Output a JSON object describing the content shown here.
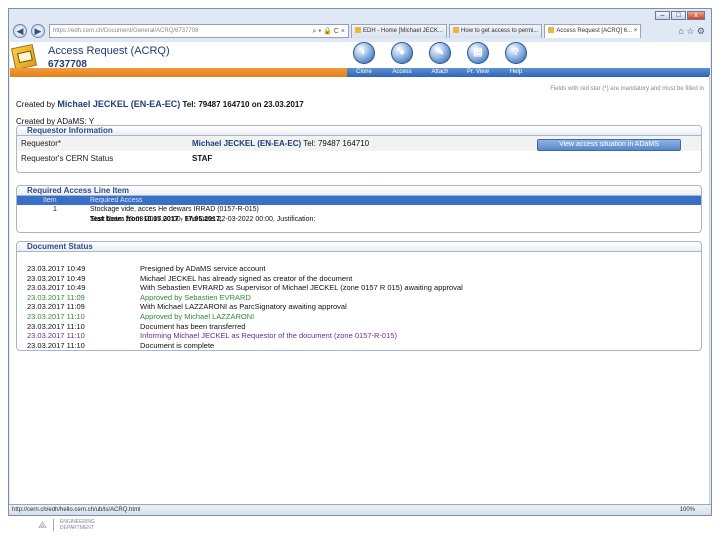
{
  "browser": {
    "address_url": "https://edh.cern.ch/Document/General/ACRQ/6737708",
    "tabs": [
      "EDH - Home [Michael JECK...",
      "How to get access to permi...",
      "Access Request [ACRQ] 6..."
    ],
    "status_url": "http://cern.ch/edh/hello.cern.ch/ub/ls/ACRQ.html",
    "zoom": "100%",
    "win_min": "–",
    "win_max": "□",
    "win_close": "x",
    "back_glyph": "◀",
    "fwd_glyph": "▶",
    "address_icons": "⌕ ▾ 🔒 C ×",
    "toolbar_icons": "⌂ ☆ ⚙",
    "tab_close": "×"
  },
  "app": {
    "title": "Access Request (ACRQ)",
    "number": "6737708",
    "actions": [
      {
        "label": "Clone",
        "icon": "clone-icon",
        "glyph": "◐"
      },
      {
        "label": "Access",
        "icon": "access-icon",
        "glyph": "●"
      },
      {
        "label": "Attach",
        "icon": "attach-icon",
        "glyph": "✎"
      },
      {
        "label": "Pr. View",
        "icon": "print-view-icon",
        "glyph": "▤"
      },
      {
        "label": "Help",
        "icon": "help-icon",
        "glyph": "?"
      }
    ],
    "mandatory_note": "Fields with red star (*) are mandatory and must be filled in"
  },
  "created": {
    "prefix": "Created by",
    "name": "Michael JECKEL (EN-EA-EC)",
    "tel": "Tel: 79487 164710 on 23.03.2017",
    "adams_line": "Created by ADaMS: Y"
  },
  "requestor": {
    "section_title": "Requestor Information",
    "requestor_label": "Requestor*",
    "requestor_name": "Michael JECKEL (EN-EA-EC)",
    "requestor_tel": "Tel: 79487 164710",
    "status_label": "Requestor's CERN Status",
    "status_value": "STAF",
    "view_button": "View access situation in ADaMS"
  },
  "line_item": {
    "section_title": "Required Access Line Item",
    "col_item": "Item",
    "col_access": "Required Access",
    "item_no": "1",
    "access": "Stockage vide, acces He dewars IRRAD (0157-R-015)",
    "detail_prefix": "Start Date: 23-03-2017 00:00, End Date: 22-03-2022 00:00, Justification:",
    "detail_bold": "Test beam from 10.05.2017 - 17.05.2017,"
  },
  "document_status": {
    "section_title": "Document Status",
    "rows": [
      {
        "dt": "23.03.2017 10:49",
        "msg": "Presigned by ADaMS service account",
        "cls": ""
      },
      {
        "dt": "23.03.2017 10:49",
        "msg": "Michael JECKEL has already signed as creator of the document",
        "cls": ""
      },
      {
        "dt": "23.03.2017 10:49",
        "msg": "With Sebastien EVRARD as Supervisor of Michael JECKEL (zone 0157 R 015) awaiting approval",
        "cls": ""
      },
      {
        "dt": "23.03.2017 11:09",
        "msg": "Approved by Sebastien EVRARD",
        "cls": "green"
      },
      {
        "dt": "23.03.2017 11:09",
        "msg": "With Michael LAZZARONI as ParcSignatory awaiting approval",
        "cls": ""
      },
      {
        "dt": "23.03.2017 11:10",
        "msg": "Approved by Michael LAZZARONI",
        "cls": "green"
      },
      {
        "dt": "23.03.2017 11:10",
        "msg": "Document has been transferred",
        "cls": ""
      },
      {
        "dt": "23.03.2017 11:10",
        "msg": "Informing Michael JECKEL as Requestor of the document (zone 0157-R-015)",
        "cls": "purple"
      },
      {
        "dt": "23.03.2017 11:10",
        "msg": "Document is complete",
        "cls": ""
      }
    ]
  },
  "footer": {
    "logo_mark": "⟁",
    "logo_text_1": "ENGINEERING",
    "logo_text_2": "DEPARTMENT"
  },
  "colors": {
    "brand_blue": "#1f3d7a",
    "orange_bar": "#e57f1c",
    "selected_row": "#3a6fc7",
    "approved": "#2f8a2f",
    "informing": "#6b2f8a"
  }
}
